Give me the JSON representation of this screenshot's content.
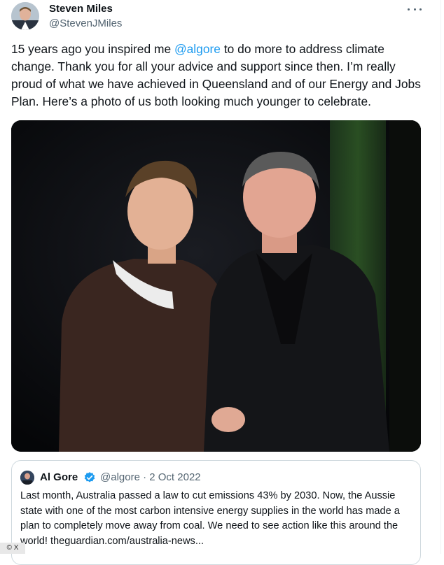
{
  "author": {
    "name": "Steven Miles",
    "handle": "@StevenJMiles"
  },
  "tweet": {
    "text_before": "15 years ago you inspired me ",
    "mention": "@algore",
    "text_after": " to do more to address climate change. Thank you for all your advice and support since then. I’m really proud of what we have achieved in Queensland and of our Energy and Jobs Plan. Here’s a photo of us both looking much younger to celebrate."
  },
  "quote": {
    "name": "Al Gore",
    "meta": "@algore · 2 Oct 2022",
    "text": "Last month, Australia passed a law to cut emissions 43% by 2030. Now, the Aussie state with one of the most carbon intensive energy supplies in the world has made a plan to completely move away from coal. We need to see action like this around the world! theguardian.com/australia-news..."
  },
  "watermark": "© X",
  "icons": {
    "more": "more-options-icon",
    "verified": "verified-badge-icon"
  },
  "colors": {
    "accent": "#1d9bf0",
    "text": "#0f1419",
    "muted": "#536471"
  }
}
